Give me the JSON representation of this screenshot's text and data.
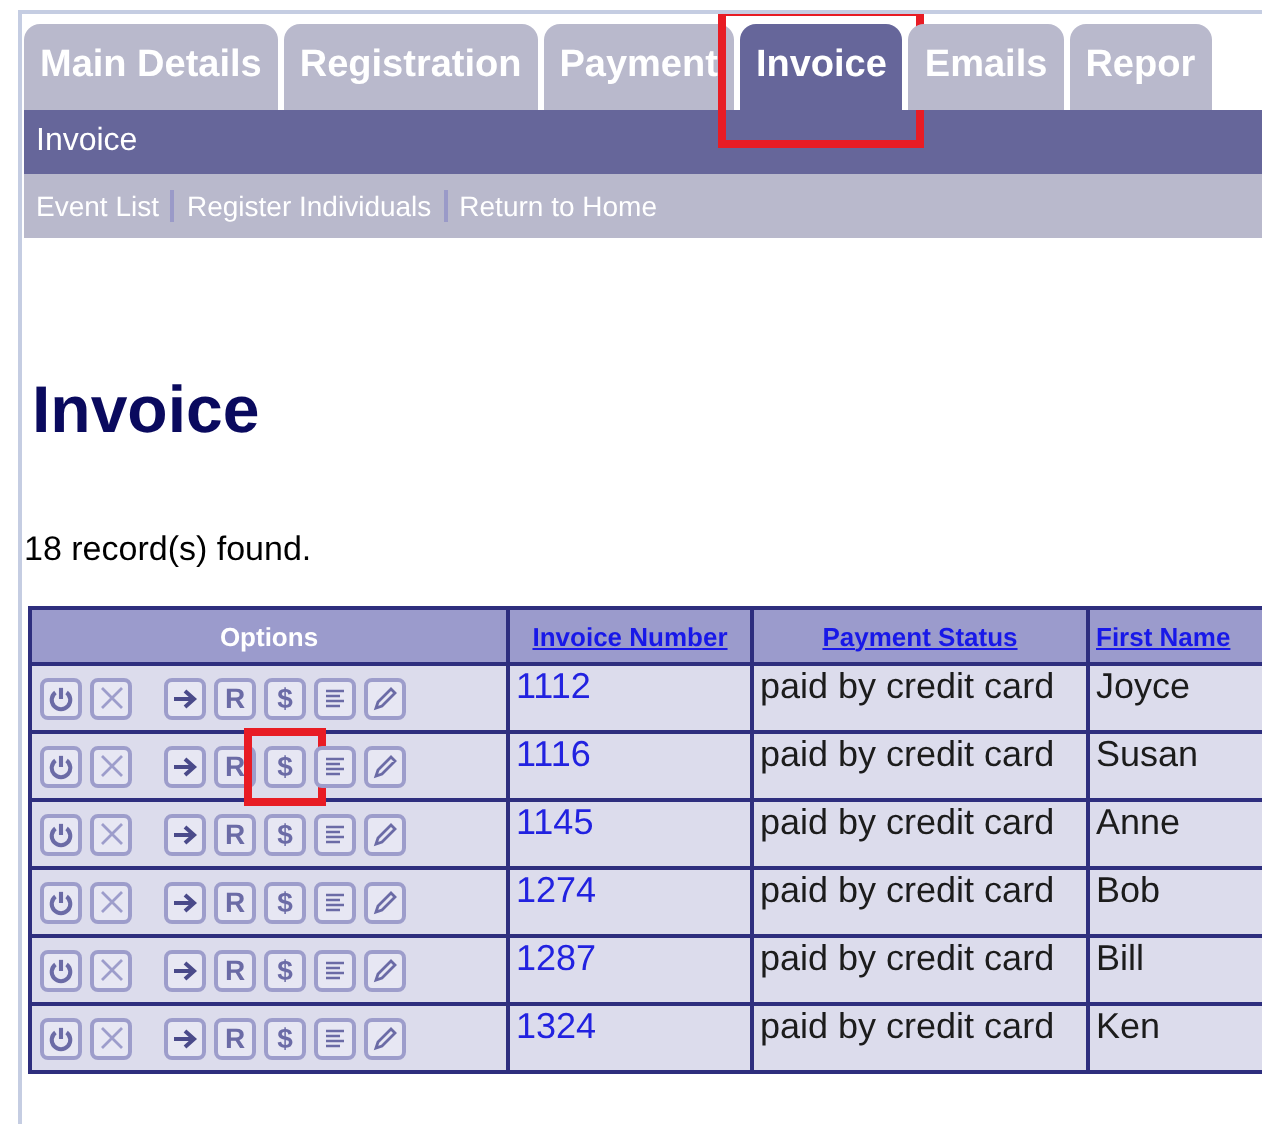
{
  "tabs": [
    {
      "label": "Main Details",
      "selected": false,
      "highlighted": false
    },
    {
      "label": "Registration",
      "selected": false,
      "highlighted": false
    },
    {
      "label": "Payment",
      "selected": false,
      "highlighted": false
    },
    {
      "label": "Invoice",
      "selected": true,
      "highlighted": true
    },
    {
      "label": "Emails",
      "selected": false,
      "highlighted": false
    },
    {
      "label": "Repor",
      "selected": false,
      "highlighted": false
    }
  ],
  "section_title": "Invoice",
  "sub_links": [
    "Event List",
    "Register Individuals",
    "Return to Home"
  ],
  "heading": "Invoice",
  "record_count": "18 record(s) found.",
  "table": {
    "columns": [
      {
        "label": "Options",
        "kind": "plain"
      },
      {
        "label": "Invoice Number",
        "kind": "link"
      },
      {
        "label": "Payment Status",
        "kind": "link"
      },
      {
        "label": "First Name",
        "kind": "link"
      }
    ],
    "rows": [
      {
        "options": [
          {
            "kind": "power",
            "highlighted": false
          },
          {
            "kind": "close",
            "highlighted": false
          },
          {
            "kind": "arrow",
            "highlighted": false
          },
          {
            "kind": "text",
            "label": "R",
            "highlighted": false
          },
          {
            "kind": "text",
            "label": "$",
            "highlighted": false
          },
          {
            "kind": "list",
            "highlighted": false
          },
          {
            "kind": "pencil",
            "highlighted": false
          }
        ],
        "invoice_number": "1112",
        "payment_status": "paid by credit card",
        "first_name": "Joyce"
      },
      {
        "options": [
          {
            "kind": "power",
            "highlighted": false
          },
          {
            "kind": "close",
            "highlighted": false
          },
          {
            "kind": "arrow",
            "highlighted": false
          },
          {
            "kind": "text",
            "label": "R",
            "highlighted": false
          },
          {
            "kind": "text",
            "label": "$",
            "highlighted": true
          },
          {
            "kind": "list",
            "highlighted": false
          },
          {
            "kind": "pencil",
            "highlighted": false
          }
        ],
        "invoice_number": "1116",
        "payment_status": "paid by credit card",
        "first_name": "Susan"
      },
      {
        "options": [
          {
            "kind": "power",
            "highlighted": false
          },
          {
            "kind": "close",
            "highlighted": false
          },
          {
            "kind": "arrow",
            "highlighted": false
          },
          {
            "kind": "text",
            "label": "R",
            "highlighted": false
          },
          {
            "kind": "text",
            "label": "$",
            "highlighted": false
          },
          {
            "kind": "list",
            "highlighted": false
          },
          {
            "kind": "pencil",
            "highlighted": false
          }
        ],
        "invoice_number": "1145",
        "payment_status": "paid by credit card",
        "first_name": "Anne"
      },
      {
        "options": [
          {
            "kind": "power",
            "highlighted": false
          },
          {
            "kind": "close",
            "highlighted": false
          },
          {
            "kind": "arrow",
            "highlighted": false
          },
          {
            "kind": "text",
            "label": "R",
            "highlighted": false
          },
          {
            "kind": "text",
            "label": "$",
            "highlighted": false
          },
          {
            "kind": "list",
            "highlighted": false
          },
          {
            "kind": "pencil",
            "highlighted": false
          }
        ],
        "invoice_number": "1274",
        "payment_status": "paid by credit card",
        "first_name": "Bob"
      },
      {
        "options": [
          {
            "kind": "power",
            "highlighted": false
          },
          {
            "kind": "close",
            "highlighted": false
          },
          {
            "kind": "arrow",
            "highlighted": false
          },
          {
            "kind": "text",
            "label": "R",
            "highlighted": false
          },
          {
            "kind": "text",
            "label": "$",
            "highlighted": false
          },
          {
            "kind": "list",
            "highlighted": false
          },
          {
            "kind": "pencil",
            "highlighted": false
          }
        ],
        "invoice_number": "1287",
        "payment_status": "paid by credit card",
        "first_name": "Bill"
      },
      {
        "options": [
          {
            "kind": "power",
            "highlighted": false
          },
          {
            "kind": "close",
            "highlighted": false
          },
          {
            "kind": "arrow",
            "highlighted": false
          },
          {
            "kind": "text",
            "label": "R",
            "highlighted": false
          },
          {
            "kind": "text",
            "label": "$",
            "highlighted": false
          },
          {
            "kind": "list",
            "highlighted": false
          },
          {
            "kind": "pencil",
            "highlighted": false
          }
        ],
        "invoice_number": "1324",
        "payment_status": "paid by credit card",
        "first_name": "Ken"
      }
    ]
  }
}
